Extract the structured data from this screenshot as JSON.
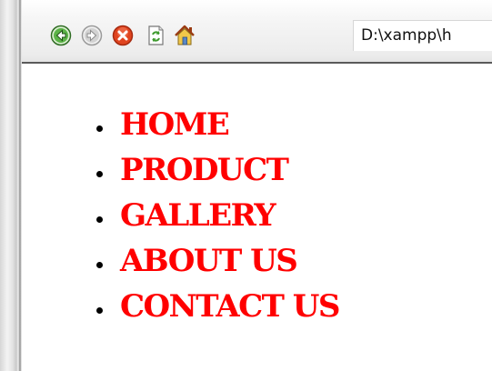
{
  "toolbar": {
    "buttons": [
      {
        "name": "back-icon",
        "color": "#3a9a2e"
      },
      {
        "name": "forward-icon",
        "color": "#b9b9b9"
      },
      {
        "name": "stop-icon",
        "color": "#e0441f"
      },
      {
        "name": "refresh-icon",
        "color": "#4aa33a"
      },
      {
        "name": "home-icon",
        "color": "#d4a22c"
      }
    ],
    "address": "D:\\xampp\\h"
  },
  "nav": {
    "color": "#ff0000",
    "items": [
      {
        "label": "HOME"
      },
      {
        "label": "PRODUCT"
      },
      {
        "label": "GALLERY"
      },
      {
        "label": "ABOUT US"
      },
      {
        "label": "CONTACT US"
      }
    ]
  }
}
